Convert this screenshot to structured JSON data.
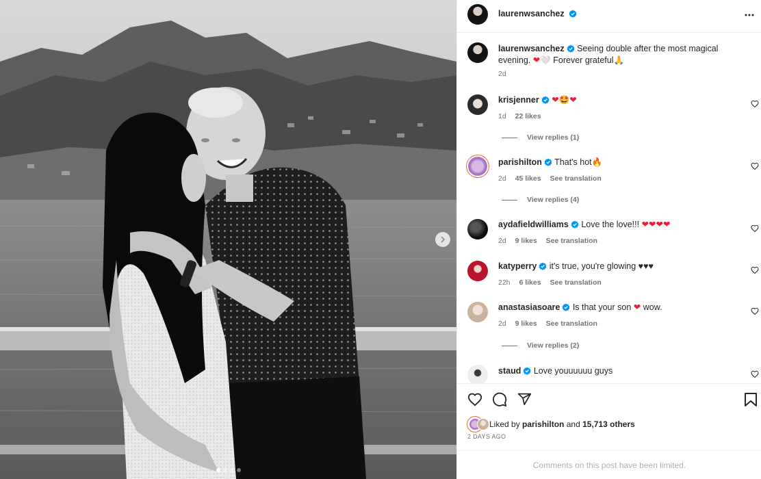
{
  "post": {
    "author": "laurenwsanchez",
    "caption_text": "Seeing double after the most magical evening.",
    "caption_emoji": "❤🤍",
    "caption_text2": "Forever grateful",
    "caption_emoji2": "🙏",
    "caption_time": "2d",
    "carousel_index": 1,
    "carousel_total": 4
  },
  "comments": [
    {
      "user": "krisjenner",
      "text": "",
      "emoji": "❤🤩❤",
      "time": "1d",
      "likes": "22 likes",
      "translation": "",
      "replies": "View replies (1)"
    },
    {
      "user": "parishilton",
      "text": "That's hot",
      "emoji": "🔥",
      "time": "2d",
      "likes": "45 likes",
      "translation": "See translation",
      "replies": "View replies (4)"
    },
    {
      "user": "aydafieldwilliams",
      "text": "Love the love!!!",
      "emoji": "❤❤❤❤",
      "time": "2d",
      "likes": "9 likes",
      "translation": "See translation",
      "replies": ""
    },
    {
      "user": "katyperry",
      "text": "it's true, you're glowing",
      "emoji": "♥♥♥",
      "time": "22h",
      "likes": "6 likes",
      "translation": "See translation",
      "replies": ""
    },
    {
      "user": "anastasiasoare",
      "text": "Is that your son",
      "emoji": "❤",
      "text_after": "wow.",
      "time": "2d",
      "likes": "9 likes",
      "translation": "See translation",
      "replies": "View replies (2)"
    },
    {
      "user": "staud",
      "text": "Love youuuuuu guys",
      "emoji": "",
      "time": "",
      "likes": "",
      "translation": "",
      "replies": ""
    }
  ],
  "likes": {
    "prefix": "Liked by",
    "user": "parishilton",
    "middle": "and",
    "count": "15,713 others"
  },
  "post_date": "2 DAYS AGO",
  "comments_limited": "Comments on this post have been limited.",
  "icons": {
    "verified": "verified-badge-icon",
    "more": "more-options-icon",
    "like": "heart-icon",
    "comment": "comment-icon",
    "share": "share-icon",
    "save": "bookmark-icon",
    "next": "chevron-right-icon"
  },
  "colors": {
    "verified": "#0095f6",
    "heart_red": "#ed1c3a",
    "muted": "#737373"
  }
}
